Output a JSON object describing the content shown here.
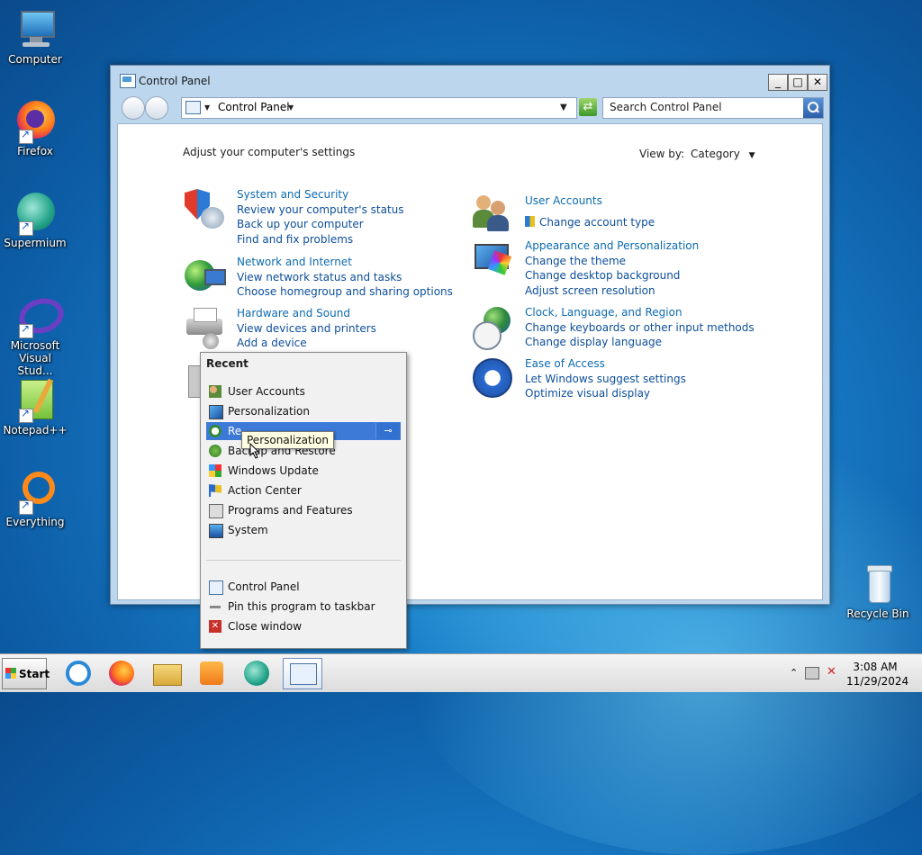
{
  "desktop": {
    "icons": [
      {
        "label": "Computer"
      },
      {
        "label": "Firefox"
      },
      {
        "label": "Supermium"
      },
      {
        "label": "Microsoft Visual Stud..."
      },
      {
        "label": "Notepad++"
      },
      {
        "label": "Everything"
      },
      {
        "label": "Recycle Bin"
      }
    ]
  },
  "window": {
    "title": "Control Panel",
    "address_path": "Control Panel",
    "search_placeholder": "Search Control Panel",
    "buttons": {
      "minimize": "_",
      "maximize": "□",
      "close": "✕"
    }
  },
  "content": {
    "heading": "Adjust your computer's settings",
    "view_by_label": "View by:",
    "view_by_value": "Category",
    "categories_left": [
      {
        "title": "System and Security",
        "links": [
          "Review your computer's status",
          "Back up your computer",
          "Find and fix problems"
        ]
      },
      {
        "title": "Network and Internet",
        "links": [
          "View network status and tasks",
          "Choose homegroup and sharing options"
        ]
      },
      {
        "title": "Hardware and Sound",
        "links": [
          "View devices and printers",
          "Add a device"
        ]
      }
    ],
    "categories_right": [
      {
        "title": "User Accounts",
        "links": [
          "Change account type"
        ]
      },
      {
        "title": "Appearance and Personalization",
        "links": [
          "Change the theme",
          "Change desktop background",
          "Adjust screen resolution"
        ]
      },
      {
        "title": "Clock, Language, and Region",
        "links": [
          "Change keyboards or other input methods",
          "Change display language"
        ]
      },
      {
        "title": "Ease of Access",
        "links": [
          "Let Windows suggest settings",
          "Optimize visual display"
        ]
      }
    ]
  },
  "jumplist": {
    "heading": "Recent",
    "recent": [
      "User Accounts",
      "Personalization",
      "Re",
      "Backup and Restore",
      "Windows Update",
      "Action Center",
      "Programs and Features",
      "System"
    ],
    "tasks": [
      "Control Panel",
      "Pin this program to taskbar",
      "Close window"
    ],
    "tooltip": "Personalization",
    "pin_glyph": "⊸"
  },
  "taskbar": {
    "start_label": "Start",
    "time": "3:08 AM",
    "date": "11/29/2024"
  },
  "colors": {
    "link": "#0c4e9a",
    "selection": "#3d7ad8",
    "desktop": "#1a7fc9"
  }
}
